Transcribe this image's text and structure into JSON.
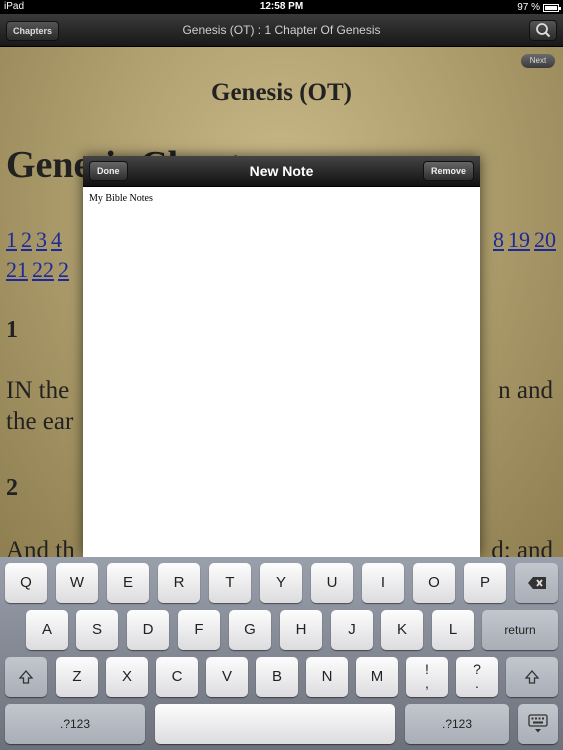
{
  "status": {
    "device": "iPad",
    "time": "12:58 PM",
    "battery": "97 %"
  },
  "nav": {
    "chapters_label": "Chapters",
    "title": "Genesis (OT) : 1 Chapter Of Genesis",
    "search_icon": "search-icon"
  },
  "content": {
    "next_label": "Next",
    "book_title": "Genesis (OT)",
    "chapter_heading": "Genesis Chapter",
    "chapter_numbers_row1": [
      "1",
      "2",
      "3",
      "4"
    ],
    "chapter_numbers_row1_right": [
      "8",
      "19",
      "20"
    ],
    "chapter_numbers_row2": [
      "21",
      "22",
      "2"
    ],
    "verse1_number": "1",
    "verse1_line1": "IN the",
    "verse1_line1_right": "n and",
    "verse1_line2": "the ear",
    "verse2_number": "2",
    "verse2_line1": "And th",
    "verse2_line1_right": "d: and"
  },
  "note": {
    "done_label": "Done",
    "title": "New Note",
    "remove_label": "Remove",
    "text": "My Bible Notes"
  },
  "keyboard": {
    "row1": [
      "Q",
      "W",
      "E",
      "R",
      "T",
      "Y",
      "U",
      "I",
      "O",
      "P"
    ],
    "backspace_icon": "backspace-icon",
    "row2": [
      "A",
      "S",
      "D",
      "F",
      "G",
      "H",
      "J",
      "K",
      "L"
    ],
    "return_label": "return",
    "shift_icon": "shift-icon",
    "row3": [
      "Z",
      "X",
      "C",
      "V",
      "B",
      "N",
      "M"
    ],
    "excl_top": "!",
    "excl_bottom": ",",
    "quest_top": "?",
    "quest_bottom": ".",
    "numbers_label": ".?123",
    "hide_keyboard_icon": "keyboard-hide-icon"
  }
}
